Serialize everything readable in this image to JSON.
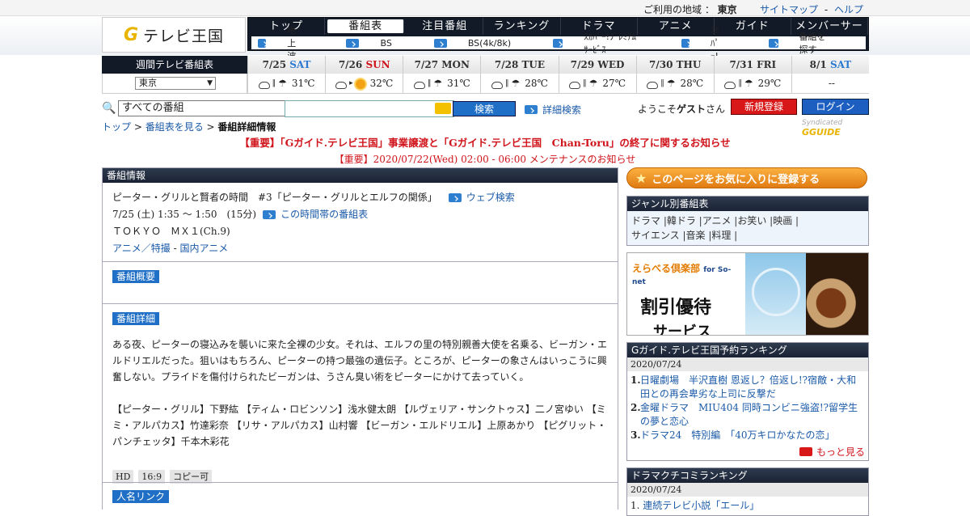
{
  "util": {
    "region_label": "ご利用の地域 ：",
    "region": "東京",
    "sitemap": "サイトマップ",
    "sep": "-",
    "help": "ヘルプ"
  },
  "logo": {
    "g": "G",
    "name": "テレビ王国",
    "tag": "GUIDE"
  },
  "nav": {
    "main": [
      "トップ",
      "番組表",
      "注目番組",
      "ランキング",
      "ドラマ",
      "アニメ",
      "ガイド",
      "メンバーサービス"
    ],
    "sub": [
      "地上波",
      "BS",
      "BS(4k/8k)",
      "ｽｶﾊﾟｰ!ﾌﾟﾚﾐｱﾑｻｰﾋﾞｽ",
      "ｽｶﾊﾟｰ!",
      "番組を探す"
    ]
  },
  "weekly": {
    "label": "週間テレビ番組表",
    "area": "東京"
  },
  "days": [
    {
      "date": "7/25",
      "dow": "SAT",
      "type": "sat",
      "icons": "cloud|umb",
      "temp": "31℃"
    },
    {
      "date": "7/26",
      "dow": "SUN",
      "type": "sun",
      "icons": "cloud>sun",
      "temp": "32℃"
    },
    {
      "date": "7/27",
      "dow": "MON",
      "type": "",
      "icons": "cloud|umb",
      "temp": "31℃"
    },
    {
      "date": "7/28",
      "dow": "TUE",
      "type": "",
      "icons": "cloud|umb",
      "temp": "28℃"
    },
    {
      "date": "7/29",
      "dow": "WED",
      "type": "",
      "icons": "cloud|umb",
      "temp": "27℃"
    },
    {
      "date": "7/30",
      "dow": "THU",
      "type": "",
      "icons": "cloud|umb",
      "temp": "28℃"
    },
    {
      "date": "7/31",
      "dow": "FRI",
      "type": "",
      "icons": "cloud|umb",
      "temp": "29℃"
    },
    {
      "date": "8/1",
      "dow": "SAT",
      "type": "sat",
      "icons": "",
      "temp": "--"
    }
  ],
  "search": {
    "category": "すべての番組",
    "button": "検索",
    "advanced": "詳細検索",
    "welcome_pre": "ようこそ",
    "welcome_user": "ゲスト",
    "welcome_suf": "さん",
    "register": "新規登録",
    "login": "ログイン"
  },
  "breadcrumb": {
    "top": "トップ",
    "sep": " > ",
    "list": "番組表を見る",
    "current": "番組詳細情報"
  },
  "syndicated": "Syndicated",
  "notice": {
    "n1": "【重要】「Gガイド.テレビ王国」事業譲渡と「Gガイド.テレビ王国　Chan-Toru」の終了に関するお知らせ",
    "n2": "【重要】2020/07/22(Wed) 02:00 - 06:00 メンテナンスのお知らせ"
  },
  "program": {
    "header": "番組情報",
    "title": "ピーター・グリルと賢者の時間　#3「ピーター・グリルとエルフの関係」",
    "web_search": "ウェブ検索",
    "time": "7/25 (土) 1:35 ～ 1:50　(15分)",
    "time_link": "この時間帯の番組表",
    "channel": "ＴＯＫＹＯ　ＭＸ１(Ch.9)",
    "genre1": "アニメ／特撮",
    "genre_sep": " - ",
    "genre2": "国内アニメ",
    "summary_tag": "番組概要",
    "detail_tag": "番組詳細",
    "detail_text": "ある夜、ピーターの寝込みを襲いに来た全裸の少女。それは、エルフの里の特別親善大使を名乗る、ビーガン・エルドリエルだった。狙いはもちろん、ピーターの持つ最強の遺伝子。ところが、ピーターの象さんはいっこうに興奮しない。プライドを傷付けられたビーガンは、うさん臭い術をピーターにかけて去っていく。",
    "cast": "【ピーター・グリル】下野紘 【ティム・ロビンソン】浅水健太朗 【ルヴェリア・サンクトゥス】二ノ宮ゆい 【ミミ・アルパカス】竹達彩奈 【リサ・アルパカス】山村響 【ビーガン・エルドリエル】上原あかり 【ピグリット・パンチェッタ】千本木彩花",
    "badges": [
      "HD",
      "16:9",
      "コピー可"
    ],
    "people_tag": "人名リンク"
  },
  "right": {
    "fav": "このページをお気に入りに登録する",
    "genre_header": "ジャンル別番組表",
    "genres_l1": "ドラマ |韓ドラ |アニメ |お笑い |映画 |",
    "genres_l2": "サイエンス |音楽 |料理 |",
    "ad_head": "えらべる倶楽部",
    "ad_for": "for So-net",
    "ad_main": "割引優待",
    "ad_sub": "サービス",
    "rank_header": "Gガイド.テレビ王国予約ランキング",
    "rank_date": "2020/07/24",
    "ranks": [
      {
        "n": "1.",
        "t": "日曜劇場　半沢直樹 恩返し？倍返し!?宿敵・大和田との再会卑劣な上司に反撃だ"
      },
      {
        "n": "2.",
        "t": "金曜ドラマ　MIU404 同時コンビニ強盗!?留学生の夢と恋心"
      },
      {
        "n": "3.",
        "t": "ドラマ24　特別編　「40万キロかなたの恋」"
      }
    ],
    "more": "もっと見る",
    "rank2_header": "ドラマクチコミランキング",
    "rank2_date": "2020/07/24",
    "rank2_first": "連続テレビ小説「エール」"
  }
}
